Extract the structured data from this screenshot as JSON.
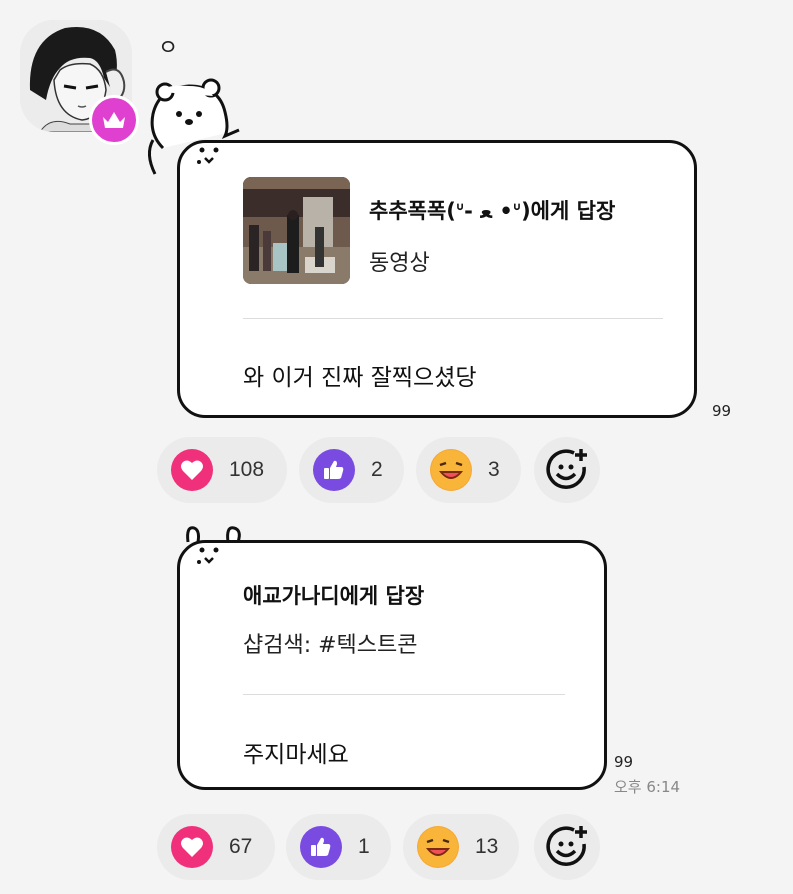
{
  "profile": {
    "name": "ㅇ"
  },
  "messages": [
    {
      "reply_title": "추추폭폭(ᐡ- ﻌ •ᐡ)에게 답장",
      "reply_preview": "동영상",
      "text": "와 이거 진짜 잘찍으셨당",
      "read_count": "99"
    },
    {
      "reply_title": "애교가나디에게 답장",
      "reply_preview": "샵검색: #텍스트콘",
      "text": "주지마세요",
      "read_count": "99",
      "time": "오후 6:14"
    }
  ],
  "reactions": [
    [
      {
        "icon": "heart-icon",
        "count": "108",
        "color": "#f0307a"
      },
      {
        "icon": "thumbs-up-icon",
        "count": "2",
        "color": "#7a4be0"
      },
      {
        "icon": "grinning-face-icon",
        "count": "3",
        "color": "#f7a832"
      }
    ],
    [
      {
        "icon": "heart-icon",
        "count": "67",
        "color": "#f0307a"
      },
      {
        "icon": "thumbs-up-icon",
        "count": "1",
        "color": "#7a4be0"
      },
      {
        "icon": "grinning-face-icon",
        "count": "13",
        "color": "#f7a832"
      }
    ]
  ],
  "colors": {
    "background": "#f4f4f4",
    "crown_badge": "#e040d0",
    "bubble_border": "#111111"
  }
}
